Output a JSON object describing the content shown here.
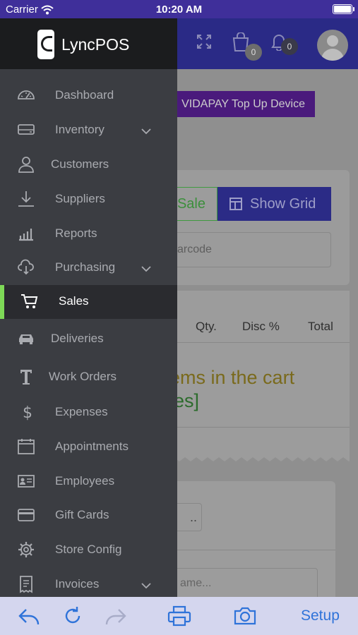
{
  "status_bar": {
    "carrier": "Carrier",
    "time": "10:20 AM"
  },
  "topbar": {
    "cart_count": "0",
    "notification_count": "0"
  },
  "main": {
    "vidapay_label": "VIDAPAY Top Up Device",
    "sale_label": "Sale",
    "show_grid_label": "Show Grid",
    "barcode_placeholder": "arcode",
    "columns": [
      "Qty.",
      "Disc %",
      "Total"
    ],
    "empty_line1": "ems in the cart",
    "empty_line2": "les]",
    "ellipsis": "..",
    "name_placeholder": "ame..."
  },
  "drawer": {
    "brand": "LyncPOS",
    "items": [
      {
        "label": "Dashboard",
        "icon": "dashboard-icon"
      },
      {
        "label": "Inventory",
        "icon": "inventory-icon",
        "expandable": true
      },
      {
        "label": "Customers",
        "icon": "customers-icon"
      },
      {
        "label": "Suppliers",
        "icon": "suppliers-icon"
      },
      {
        "label": "Reports",
        "icon": "reports-icon"
      },
      {
        "label": "Purchasing",
        "icon": "purchasing-icon",
        "expandable": true
      },
      {
        "label": "Sales",
        "icon": "cart-icon",
        "active": true
      },
      {
        "label": "Deliveries",
        "icon": "car-icon"
      },
      {
        "label": "Work Orders",
        "icon": "work-orders-icon"
      },
      {
        "label": "Expenses",
        "icon": "dollar-icon"
      },
      {
        "label": "Appointments",
        "icon": "calendar-icon"
      },
      {
        "label": "Employees",
        "icon": "id-card-icon"
      },
      {
        "label": "Gift Cards",
        "icon": "credit-card-icon"
      },
      {
        "label": "Store Config",
        "icon": "gear-icon"
      },
      {
        "label": "Invoices",
        "icon": "receipt-icon",
        "expandable": true
      }
    ]
  },
  "toolbar": {
    "setup_label": "Setup"
  },
  "colors": {
    "active_indicator": "#7ed957",
    "toolbar_tint": "#2f73d9",
    "drawer_bg": "#3b3d42"
  }
}
